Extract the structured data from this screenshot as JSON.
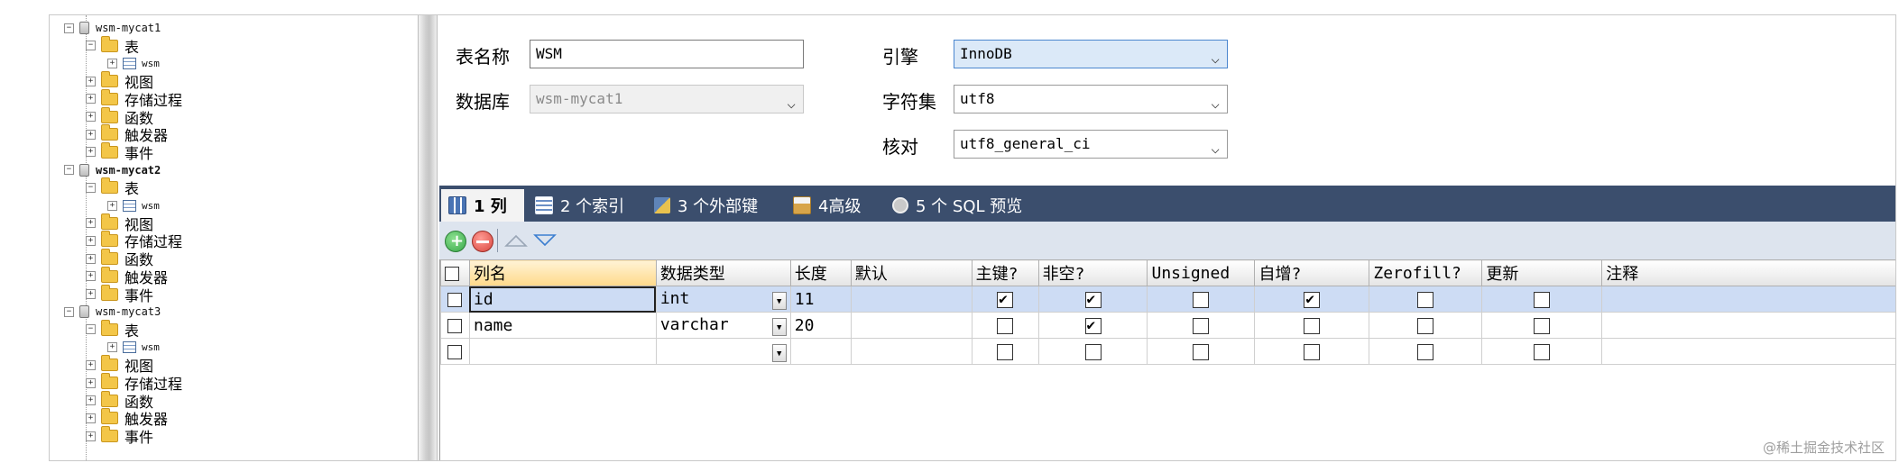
{
  "tree": [
    {
      "type": "db",
      "label": "wsm-mycat1",
      "bold": false,
      "children": [
        {
          "type": "folder",
          "label": "表",
          "expanded": true,
          "children": [
            {
              "type": "table",
              "label": "wsm"
            }
          ]
        },
        {
          "type": "folder",
          "label": "视图"
        },
        {
          "type": "folder",
          "label": "存储过程"
        },
        {
          "type": "folder",
          "label": "函数"
        },
        {
          "type": "folder",
          "label": "触发器"
        },
        {
          "type": "folder",
          "label": "事件"
        }
      ]
    },
    {
      "type": "db",
      "label": "wsm-mycat2",
      "bold": true,
      "children": [
        {
          "type": "folder",
          "label": "表",
          "expanded": true,
          "children": [
            {
              "type": "table",
              "label": "wsm"
            }
          ]
        },
        {
          "type": "folder",
          "label": "视图"
        },
        {
          "type": "folder",
          "label": "存储过程"
        },
        {
          "type": "folder",
          "label": "函数"
        },
        {
          "type": "folder",
          "label": "触发器"
        },
        {
          "type": "folder",
          "label": "事件"
        }
      ]
    },
    {
      "type": "db",
      "label": "wsm-mycat3",
      "bold": false,
      "children": [
        {
          "type": "folder",
          "label": "表",
          "expanded": true,
          "children": [
            {
              "type": "table",
              "label": "wsm"
            }
          ]
        },
        {
          "type": "folder",
          "label": "视图"
        },
        {
          "type": "folder",
          "label": "存储过程"
        },
        {
          "type": "folder",
          "label": "函数"
        },
        {
          "type": "folder",
          "label": "触发器"
        },
        {
          "type": "folder",
          "label": "事件"
        }
      ]
    }
  ],
  "form": {
    "table_name_label": "表名称",
    "table_name_value": "WSM",
    "database_label": "数据库",
    "database_value": "wsm-mycat1",
    "engine_label": "引擎",
    "engine_value": "InnoDB",
    "charset_label": "字符集",
    "charset_value": "utf8",
    "collation_label": "核对",
    "collation_value": "utf8_general_ci"
  },
  "tabs": [
    {
      "label": "1 列",
      "active": true,
      "color": "#4a74b4"
    },
    {
      "label": "2 个索引",
      "active": false,
      "color": "#6a8fc6"
    },
    {
      "label": "3 个外部键",
      "active": false,
      "color": "#5f84b8"
    },
    {
      "label": "4高级",
      "active": false,
      "color": "#d8a54a"
    },
    {
      "label": "5 个 SQL 预览",
      "active": false,
      "color": "#c9c9c9"
    }
  ],
  "grid": {
    "headers": [
      "列名",
      "数据类型",
      "长度",
      "默认",
      "主键?",
      "非空?",
      "Unsigned",
      "自增?",
      "Zerofill?",
      "更新",
      "注释"
    ],
    "rows": [
      {
        "name": "id",
        "type": "int",
        "length": "11",
        "default": "",
        "pk": true,
        "notnull": true,
        "unsigned": false,
        "autoinc": true,
        "zerofill": false,
        "update": false,
        "comment": "",
        "selected": true
      },
      {
        "name": "name",
        "type": "varchar",
        "length": "20",
        "default": "",
        "pk": false,
        "notnull": true,
        "unsigned": false,
        "autoinc": false,
        "zerofill": false,
        "update": false,
        "comment": "",
        "selected": false
      },
      {
        "name": "",
        "type": "",
        "length": "",
        "default": "",
        "pk": false,
        "notnull": false,
        "unsigned": false,
        "autoinc": false,
        "zerofill": false,
        "update": false,
        "comment": "",
        "selected": false
      }
    ]
  },
  "watermark": "@稀土掘金技术社区",
  "colors": {
    "tabbar": "#3b4e6d",
    "toolbar": "#dde4ee",
    "selected_row": "#cddcf4",
    "add": "#3aa84a",
    "remove": "#d9473f"
  }
}
